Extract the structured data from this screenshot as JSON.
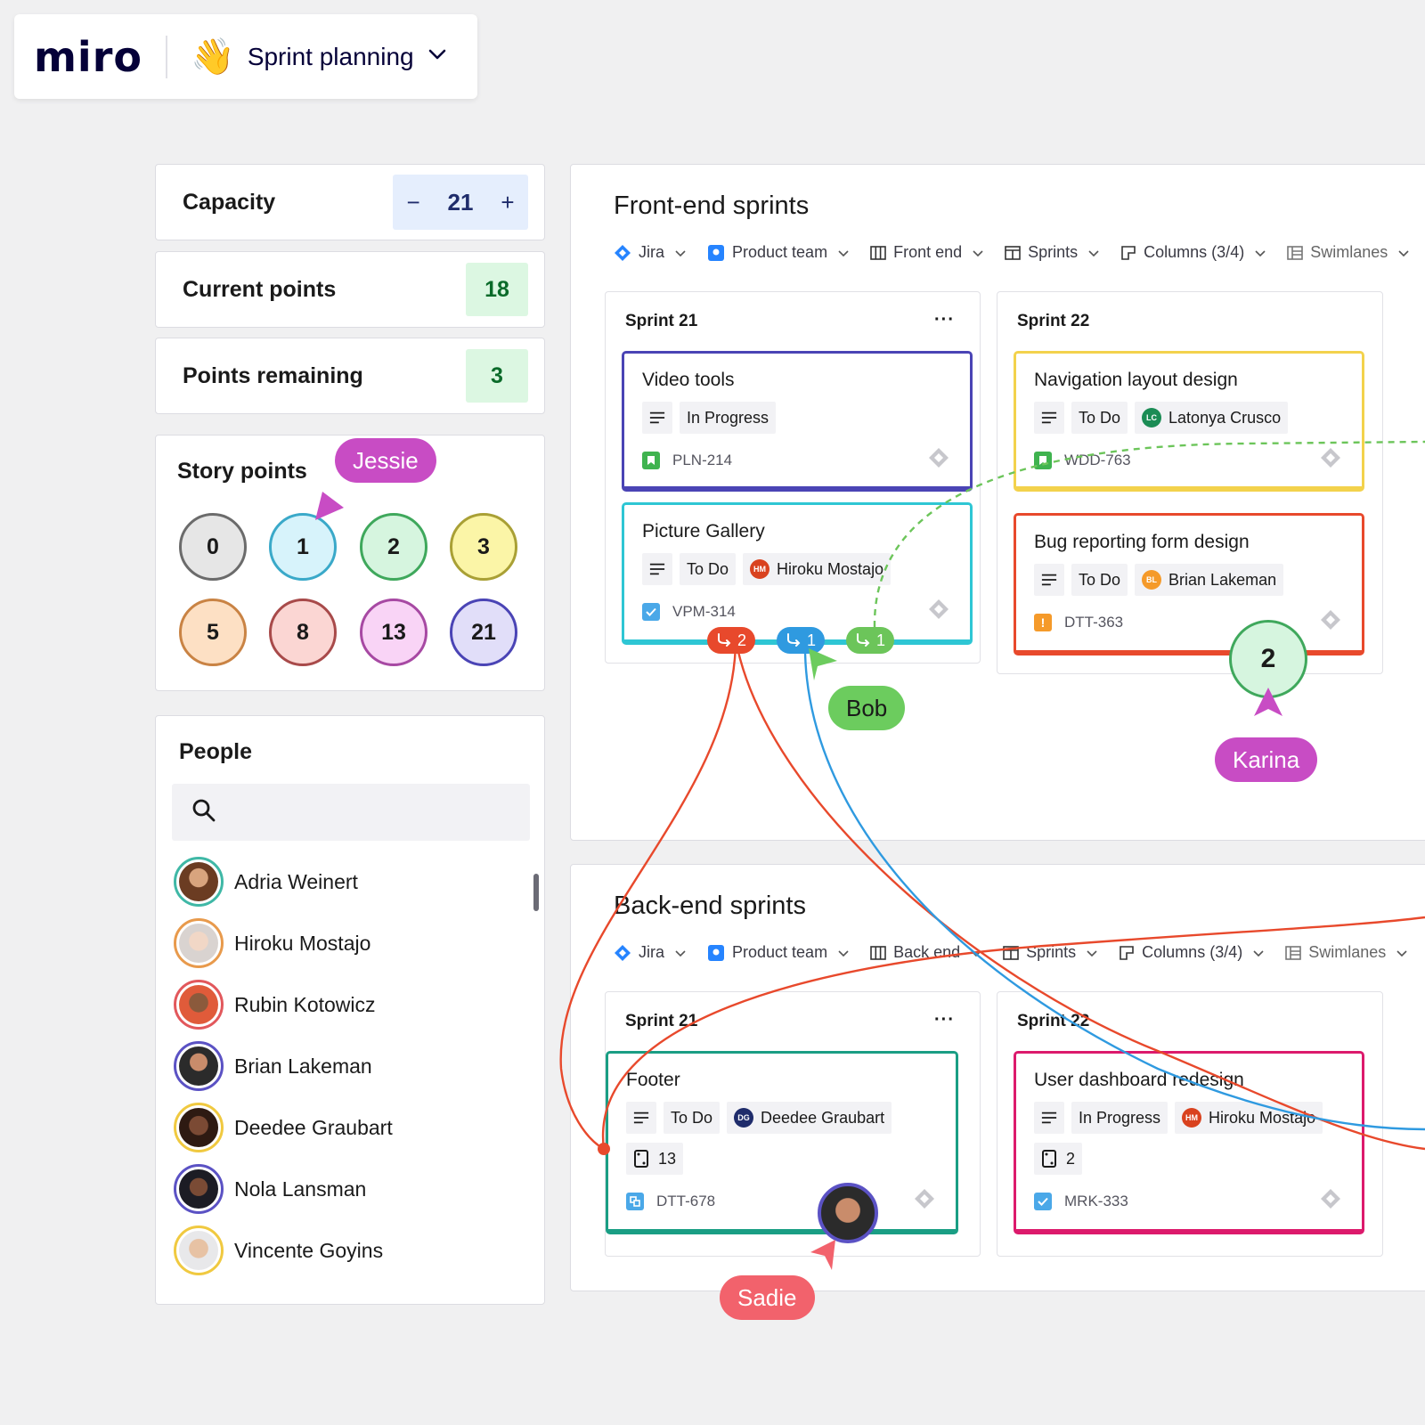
{
  "topbar": {
    "logo": "miro",
    "board_name": "Sprint planning",
    "wave_emoji": "👋"
  },
  "metrics": {
    "capacity": {
      "label": "Capacity",
      "minus": "−",
      "value": "21",
      "plus": "+"
    },
    "current_points": {
      "label": "Current points",
      "value": "18"
    },
    "points_remaining": {
      "label": "Points remaining",
      "value": "3"
    }
  },
  "story_points": {
    "title": "Story points",
    "values": [
      "0",
      "1",
      "2",
      "3",
      "5",
      "8",
      "13",
      "21"
    ]
  },
  "people": {
    "title": "People",
    "search_placeholder": "",
    "list": [
      {
        "name": "Adria Weinert"
      },
      {
        "name": "Hiroku Mostajo"
      },
      {
        "name": "Rubin Kotowicz"
      },
      {
        "name": "Brian Lakeman"
      },
      {
        "name": "Deedee Graubart"
      },
      {
        "name": "Nola Lansman"
      },
      {
        "name": "Vincente Goyins"
      }
    ]
  },
  "frontend": {
    "title": "Front-end sprints",
    "toolbar": {
      "jira": "Jira",
      "team": "Product team",
      "board": "Front end",
      "sprints": "Sprints",
      "columns": "Columns (3/4)",
      "swimlanes": "Swimlanes"
    },
    "columns": [
      {
        "title": "Sprint 21",
        "menu": "···"
      },
      {
        "title": "Sprint 22"
      }
    ],
    "cards": {
      "video_tools": {
        "title": "Video tools",
        "status": "In Progress",
        "key": "PLN-214"
      },
      "picture_gallery": {
        "title": "Picture Gallery",
        "status": "To Do",
        "assignee": "Hiroku Mostajo",
        "assignee_initials": "HM",
        "key": "VPM-314"
      },
      "navigation": {
        "title": "Navigation layout design",
        "status": "To Do",
        "assignee": "Latonya Crusco",
        "assignee_initials": "LC",
        "key": "WDD-763"
      },
      "bug_form": {
        "title": "Bug reporting form design",
        "status": "To Do",
        "assignee": "Brian Lakeman",
        "assignee_initials": "BL",
        "key": "DTT-363"
      }
    },
    "dependencies": [
      {
        "count": "2"
      },
      {
        "count": "1"
      },
      {
        "count": "1"
      }
    ]
  },
  "backend": {
    "title": "Back-end sprints",
    "toolbar": {
      "jira": "Jira",
      "team": "Product team",
      "board": "Back end",
      "sprints": "Sprints",
      "columns": "Columns (3/4)",
      "swimlanes": "Swimlanes"
    },
    "columns": [
      {
        "title": "Sprint 21",
        "menu": "···"
      },
      {
        "title": "Sprint 22"
      }
    ],
    "cards": {
      "footer": {
        "title": "Footer",
        "status": "To Do",
        "assignee": "Deedee Graubart",
        "assignee_initials": "DG",
        "points": "13",
        "key": "DTT-678"
      },
      "user_dashboard": {
        "title": "User dashboard redesign",
        "status": "In Progress",
        "assignee": "Hiroku Mostajo",
        "assignee_initials": "HM",
        "points": "2",
        "key": "MRK-333"
      }
    }
  },
  "cursors": {
    "jessie": "Jessie",
    "bob": "Bob",
    "karina": "Karina",
    "sadie": "Sadie",
    "karina_vote": "2"
  },
  "colors": {
    "jessie": "#c84cc4",
    "bob": "#6ccc5e",
    "karina": "#c84cc4",
    "sadie": "#f2626c",
    "red_link": "#e8492c",
    "blue_link": "#2f9ae0",
    "green_link": "#6cc55a"
  }
}
